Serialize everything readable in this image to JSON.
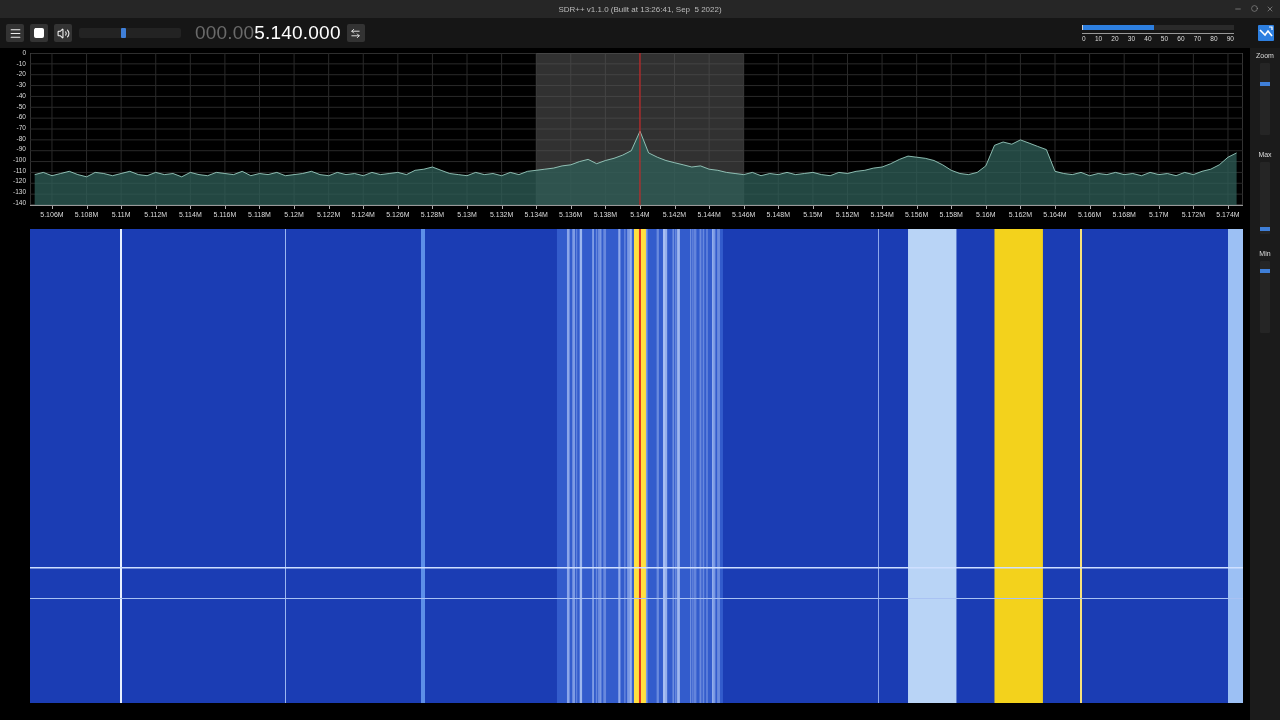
{
  "window": {
    "title": "SDR++ v1.1.0 (Built at 13:26:41, Sep  5 2022)"
  },
  "toolbar": {
    "playing": true,
    "volume": {
      "level": 0.43
    },
    "frequency": {
      "dim_digits": "000.00",
      "digits": "5.140.000"
    }
  },
  "snr_meter": {
    "level": 0.47,
    "ticks": [
      "0",
      "10",
      "20",
      "30",
      "40",
      "50",
      "60",
      "70",
      "80",
      "90"
    ]
  },
  "spectrum": {
    "chart_data": {
      "type": "line",
      "grid": true,
      "xlim": [
        5.10473,
        5.17487
      ],
      "ylim": [
        -140,
        0
      ],
      "bands": [
        {
          "axis": "x",
          "from": 5.134,
          "to": 5.146,
          "color": "#5a5a5a"
        }
      ],
      "ref_lines": [
        {
          "axis": "x",
          "value": 5.14,
          "color": "#e02020"
        }
      ],
      "yticks": [
        0,
        -10,
        -20,
        -30,
        -40,
        -50,
        -60,
        -70,
        -80,
        -90,
        -100,
        -110,
        -120,
        -130,
        -140
      ],
      "xticks": [
        {
          "value": 5.106,
          "label": "5.106M"
        },
        {
          "value": 5.108,
          "label": "5.108M"
        },
        {
          "value": 5.11,
          "label": "5.11M"
        },
        {
          "value": 5.112,
          "label": "5.112M"
        },
        {
          "value": 5.114,
          "label": "5.114M"
        },
        {
          "value": 5.116,
          "label": "5.116M"
        },
        {
          "value": 5.118,
          "label": "5.118M"
        },
        {
          "value": 5.12,
          "label": "5.12M"
        },
        {
          "value": 5.122,
          "label": "5.122M"
        },
        {
          "value": 5.124,
          "label": "5.124M"
        },
        {
          "value": 5.126,
          "label": "5.126M"
        },
        {
          "value": 5.128,
          "label": "5.128M"
        },
        {
          "value": 5.13,
          "label": "5.13M"
        },
        {
          "value": 5.132,
          "label": "5.132M"
        },
        {
          "value": 5.134,
          "label": "5.134M"
        },
        {
          "value": 5.136,
          "label": "5.136M"
        },
        {
          "value": 5.138,
          "label": "5.138M"
        },
        {
          "value": 5.14,
          "label": "5.14M"
        },
        {
          "value": 5.142,
          "label": "5.142M"
        },
        {
          "value": 5.144,
          "label": "5.144M"
        },
        {
          "value": 5.146,
          "label": "5.146M"
        },
        {
          "value": 5.148,
          "label": "5.148M"
        },
        {
          "value": 5.15,
          "label": "5.15M"
        },
        {
          "value": 5.152,
          "label": "5.152M"
        },
        {
          "value": 5.154,
          "label": "5.154M"
        },
        {
          "value": 5.156,
          "label": "5.156M"
        },
        {
          "value": 5.158,
          "label": "5.158M"
        },
        {
          "value": 5.16,
          "label": "5.16M"
        },
        {
          "value": 5.162,
          "label": "5.162M"
        },
        {
          "value": 5.164,
          "label": "5.164M"
        },
        {
          "value": 5.166,
          "label": "5.166M"
        },
        {
          "value": 5.168,
          "label": "5.168M"
        },
        {
          "value": 5.17,
          "label": "5.17M"
        },
        {
          "value": 5.172,
          "label": "5.172M"
        },
        {
          "value": 5.174,
          "label": "5.174M"
        }
      ],
      "x": [
        5.105,
        5.1055,
        5.106,
        5.1065,
        5.107,
        5.1075,
        5.108,
        5.1085,
        5.109,
        5.1095,
        5.11,
        5.1105,
        5.111,
        5.1115,
        5.112,
        5.1125,
        5.113,
        5.1135,
        5.114,
        5.1145,
        5.115,
        5.1155,
        5.116,
        5.1165,
        5.117,
        5.1175,
        5.118,
        5.1185,
        5.119,
        5.1195,
        5.12,
        5.1205,
        5.121,
        5.1215,
        5.122,
        5.1225,
        5.123,
        5.1235,
        5.124,
        5.1245,
        5.125,
        5.1255,
        5.126,
        5.1265,
        5.127,
        5.1275,
        5.128,
        5.1285,
        5.129,
        5.1295,
        5.13,
        5.1305,
        5.131,
        5.1315,
        5.132,
        5.1325,
        5.133,
        5.1335,
        5.134,
        5.1345,
        5.135,
        5.1355,
        5.136,
        5.1365,
        5.137,
        5.1375,
        5.138,
        5.1385,
        5.139,
        5.1395,
        5.14,
        5.1405,
        5.141,
        5.1415,
        5.142,
        5.1425,
        5.143,
        5.1435,
        5.144,
        5.1445,
        5.145,
        5.1455,
        5.146,
        5.1465,
        5.147,
        5.1475,
        5.148,
        5.1485,
        5.149,
        5.1495,
        5.15,
        5.1505,
        5.151,
        5.1515,
        5.152,
        5.1525,
        5.153,
        5.1535,
        5.154,
        5.1545,
        5.155,
        5.1555,
        5.156,
        5.1565,
        5.157,
        5.1575,
        5.158,
        5.1585,
        5.159,
        5.1595,
        5.16,
        5.1605,
        5.161,
        5.1615,
        5.162,
        5.1625,
        5.163,
        5.1635,
        5.164,
        5.1645,
        5.165,
        5.1655,
        5.166,
        5.1665,
        5.167,
        5.1675,
        5.168,
        5.1685,
        5.169,
        5.1695,
        5.17,
        5.1705,
        5.171,
        5.1715,
        5.172,
        5.1725,
        5.173,
        5.1735,
        5.174,
        5.1745
      ],
      "series": [
        {
          "color": "#a8e0d2",
          "values": [
            -112,
            -110,
            -113,
            -111,
            -109,
            -112,
            -114,
            -110,
            -111,
            -113,
            -111,
            -109,
            -112,
            -113,
            -110,
            -112,
            -111,
            -114,
            -110,
            -112,
            -113,
            -110,
            -111,
            -112,
            -109,
            -113,
            -111,
            -112,
            -110,
            -113,
            -112,
            -111,
            -109,
            -112,
            -113,
            -110,
            -112,
            -111,
            -113,
            -110,
            -112,
            -111,
            -110,
            -112,
            -108,
            -107,
            -105,
            -108,
            -111,
            -112,
            -113,
            -110,
            -112,
            -111,
            -113,
            -110,
            -112,
            -109,
            -108,
            -107,
            -106,
            -104,
            -103,
            -100,
            -98,
            -102,
            -99,
            -97,
            -94,
            -90,
            -72,
            -92,
            -96,
            -99,
            -101,
            -103,
            -105,
            -104,
            -107,
            -108,
            -110,
            -111,
            -112,
            -110,
            -113,
            -111,
            -112,
            -110,
            -112,
            -111,
            -110,
            -112,
            -113,
            -110,
            -111,
            -109,
            -108,
            -106,
            -105,
            -102,
            -98,
            -95,
            -96,
            -97,
            -99,
            -103,
            -108,
            -111,
            -112,
            -110,
            -104,
            -85,
            -82,
            -84,
            -80,
            -83,
            -86,
            -89,
            -109,
            -111,
            -112,
            -110,
            -113,
            -111,
            -112,
            -110,
            -112,
            -111,
            -113,
            -110,
            -112,
            -111,
            -113,
            -110,
            -112,
            -109,
            -107,
            -103,
            -96,
            -92
          ]
        }
      ]
    }
  },
  "side_sliders": [
    {
      "label": "Zoom",
      "level": 0.72
    },
    {
      "label": "Max",
      "level": 0.04
    },
    {
      "label": "Min",
      "level": 0.88
    }
  ]
}
